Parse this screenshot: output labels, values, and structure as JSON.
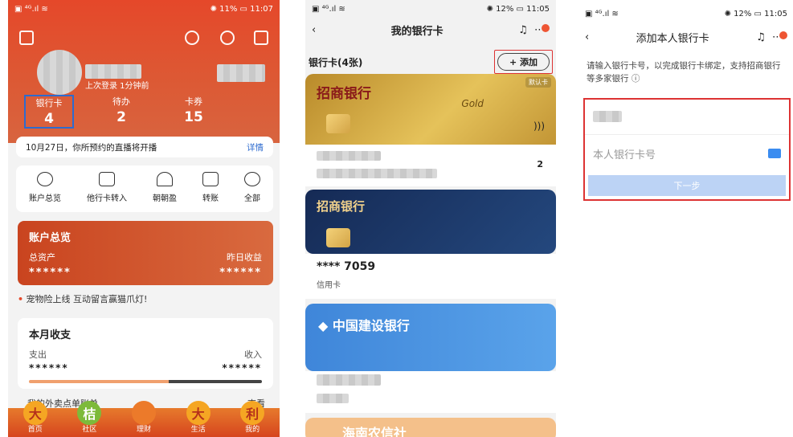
{
  "phone1": {
    "status_time": "11:07",
    "status_battery": "11%",
    "last_login": "上次登录 1分钟前",
    "stats": [
      {
        "label": "银行卡",
        "value": "4"
      },
      {
        "label": "待办",
        "value": "2"
      },
      {
        "label": "卡券",
        "value": "15"
      }
    ],
    "notice_text": "10月27日，你所预约的直播将开播",
    "notice_link": "详情",
    "menu": [
      "账户总览",
      "他行卡转入",
      "朝朝盈",
      "转账",
      "全部"
    ],
    "overview": {
      "title": "账户总览",
      "total_label": "总资产",
      "yield_label": "昨日收益",
      "total_value": "******",
      "yield_value": "******"
    },
    "promo": "宠物险上线 互动留言赢猫爪灯!",
    "month": {
      "title": "本月收支",
      "expense_label": "支出",
      "income_label": "收入",
      "expense_value": "******",
      "income_value": "******"
    },
    "takeout_label": "我的外卖点单账单",
    "takeout_link": "查看",
    "tabs": [
      {
        "label": "首页",
        "ball": "大"
      },
      {
        "label": "社区",
        "ball": "桔"
      },
      {
        "label": "理财",
        "ball": ""
      },
      {
        "label": "生活",
        "ball": "大"
      },
      {
        "label": "我的",
        "ball": "利"
      }
    ]
  },
  "phone2": {
    "status_time": "11:05",
    "status_battery": "12%",
    "title": "我的银行卡",
    "cards_header": "银行卡(4张)",
    "add_label": "+ 添加",
    "gold_card": {
      "bank": "招商银行",
      "sub": "Gold",
      "default_label": "默认卡",
      "page": "2"
    },
    "navy_card": {
      "bank": "招商银行",
      "number": "**** 7059",
      "type": "信用卡"
    },
    "ccb_card": {
      "bank": "中国建设银行"
    },
    "orange_card": {
      "bank": "海南农信社"
    }
  },
  "phone3": {
    "status_time": "11:05",
    "status_battery": "12%",
    "title": "添加本人银行卡",
    "intro": "请输入银行卡号，以完成银行卡绑定，支持招商银行等多家银行",
    "card_placeholder": "本人银行卡号",
    "next_label": "下一步"
  }
}
